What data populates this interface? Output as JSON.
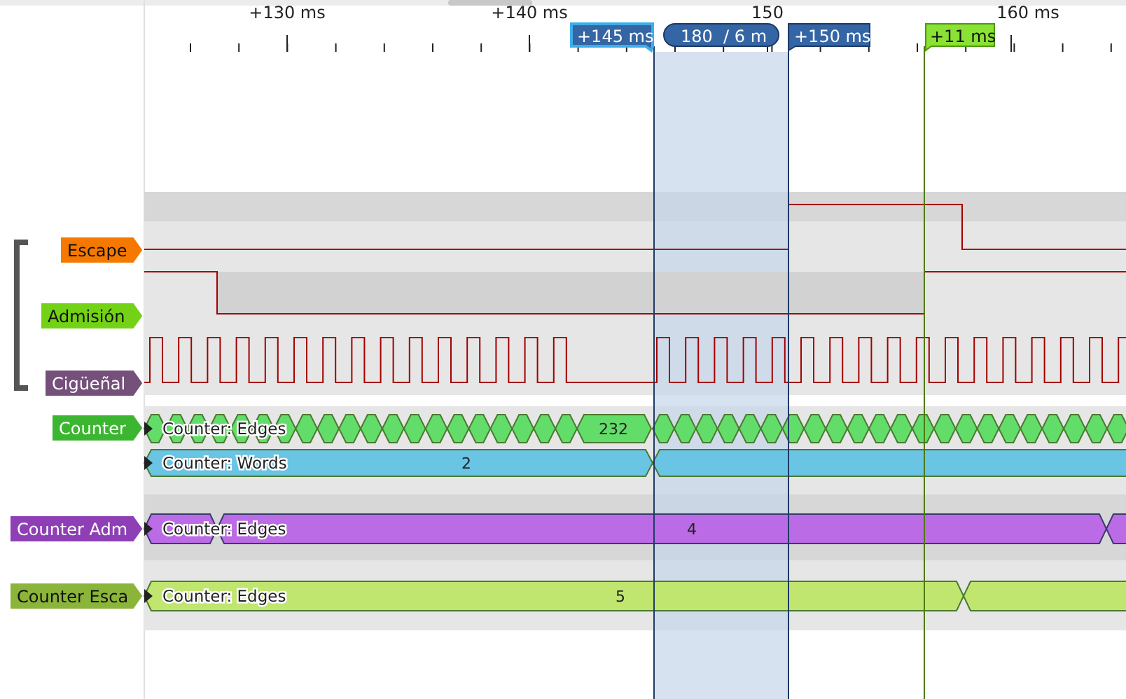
{
  "ruler": {
    "labels": [
      "+130 ms",
      "+140 ms",
      "150",
      "160 ms"
    ]
  },
  "markers": [
    {
      "kind": "cursor",
      "label": "+145 ms",
      "selected": true
    },
    {
      "kind": "span",
      "label": "180  / 6 m"
    },
    {
      "kind": "cursor",
      "label": "+150 ms",
      "selected": false
    },
    {
      "kind": "flag",
      "label": "+11 ms"
    }
  ],
  "channels": [
    {
      "name": "Escape",
      "color": "#f57900"
    },
    {
      "name": "Admisión",
      "color": "#73d216"
    },
    {
      "name": "Cigüeñal",
      "color": "#75507b"
    }
  ],
  "decoders": [
    {
      "name": "Counter",
      "color": "#3cb531",
      "rows": [
        {
          "kind": "edges",
          "title": "Counter: Edges",
          "value": "232",
          "color": "#63dd6a"
        },
        {
          "kind": "words",
          "title": "Counter: Words",
          "value": "2",
          "color": "#6ac4e4"
        }
      ]
    },
    {
      "name": "Counter Adm",
      "color": "#8e3fb5",
      "rows": [
        {
          "kind": "edges",
          "title": "Counter: Edges",
          "value": "4",
          "color": "#bc6be6"
        }
      ]
    },
    {
      "name": "Counter Esca",
      "color": "#8bb53a",
      "rows": [
        {
          "kind": "edges",
          "title": "Counter: Edges",
          "value": "5",
          "color": "#c0e670"
        }
      ]
    }
  ]
}
